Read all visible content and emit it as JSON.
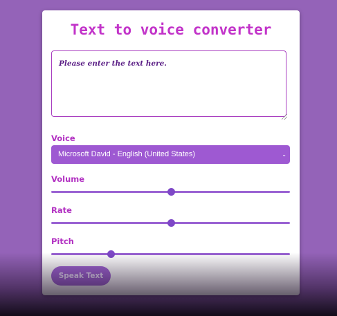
{
  "app": {
    "title": "Text to voice converter"
  },
  "text_input": {
    "placeholder": "Please enter the text here.",
    "value": ""
  },
  "voice": {
    "label": "Voice",
    "selected": "Microsoft David - English (United States)",
    "chevron_icon": "chevron-down-icon"
  },
  "volume": {
    "label": "Volume",
    "value_fraction": 0.5
  },
  "rate": {
    "label": "Rate",
    "value_fraction": 0.5
  },
  "pitch": {
    "label": "Pitch",
    "value_fraction": 0.25
  },
  "speak_button": {
    "label": "Speak Text"
  },
  "colors": {
    "page_background": "#9463b8",
    "title": "#c233c9",
    "label": "#b231c2",
    "accent": "#9e59d2",
    "slider_thumb": "#7e48c7"
  }
}
